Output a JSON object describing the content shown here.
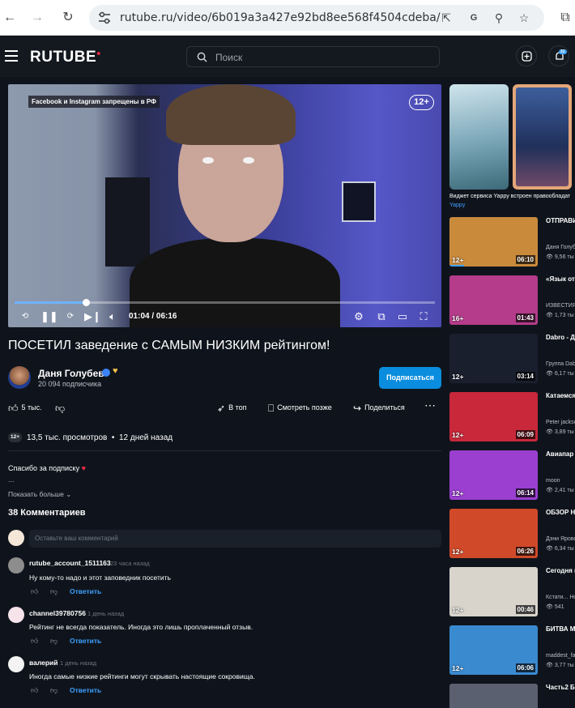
{
  "browser": {
    "url": "rutube.ru/video/6b019a3a427e92bd8ee568f4504cdeba/"
  },
  "header": {
    "logo": "RUTUBE",
    "search_placeholder": "Поиск",
    "notif_count": "31"
  },
  "player": {
    "overlay_tag": "Facebook и Instagram запрещены в РФ",
    "age_badge": "12+",
    "time": "01:04 / 06:16",
    "progress": 0.17
  },
  "video": {
    "title": "ПОСЕТИЛ заведение с САМЫМ НИЗКИМ рейтингом!",
    "channel": "Даня Голубев",
    "subscribers": "20 094 подписчика",
    "subscribe_label": "Подписаться",
    "likes": "5 тыс.",
    "actions": {
      "top": "В топ",
      "later": "Смотреть позже",
      "share": "Поделиться"
    },
    "age": "12+",
    "views": "13,5 тыс. просмотров",
    "date": "12 дней назад",
    "description": "Спасибо за подписку",
    "description_more": "...",
    "show_more": "Показать больше"
  },
  "comments": {
    "count_label": "38 Комментариев",
    "input_placeholder": "Оставьте ваш комментарий",
    "reply_label": "Ответить",
    "items": [
      {
        "user": "rutube_account_1511163",
        "time": "23 часа назад",
        "text": "Ну кому-то надо и этот заповедник посетить"
      },
      {
        "user": "channel39780756",
        "time": "1 день назад",
        "text": "Рейтинг не всегда показатель. Иногда это лишь проплаченный отзыв."
      },
      {
        "user": "валерий",
        "time": "1 день назад",
        "text": "Иногда самые низкие рейтинги могут скрывать настоящие сокровища."
      }
    ]
  },
  "sidebar": {
    "ad_text": "Виджет сервиса Yappy встроен правообладат",
    "ad_source": "Yappy",
    "cards": [
      {
        "title": "ОТПРАВИ лет НАЗА",
        "author": "Даня Голуб",
        "views": "9,56 ты",
        "age": "12+",
        "duration": "06:10",
        "bg": "#c98a3c"
      },
      {
        "title": "«Язык от домашни",
        "author": "ИЗВЕСТИЯ",
        "views": "1,73 ты",
        "age": "16+",
        "duration": "01:43",
        "bg": "#b43c8a"
      },
      {
        "title": "Dabro - Д навсегда",
        "author": "Группа Dabr",
        "views": "6,17 ты",
        "age": "12+",
        "duration": "03:14",
        "bg": "#1a1f2e"
      },
      {
        "title": "Катаемся Китайца",
        "author": "Peter jacksc",
        "views": "3,89 ты",
        "age": "12+",
        "duration": "06:09",
        "bg": "#c8283a"
      },
      {
        "title": "Авиапар Смешны",
        "author": "moon",
        "views": "2,41 ты",
        "age": "12+",
        "duration": "06:14",
        "bg": "#9a3fd0"
      },
      {
        "title": "ОБЗОР Н РЕАЛИТ",
        "author": "Дэни Яровс",
        "views": "6,34 ты",
        "age": "12+",
        "duration": "06:26",
        "bg": "#d04a2a"
      },
      {
        "title": "Сегодня программ",
        "author": "Кстати... Но",
        "views": "541",
        "age": "12+",
        "duration": "00:46",
        "bg": "#d8d4cc"
      },
      {
        "title": "БИТВА М Бешеная",
        "author": "maddest_fa",
        "views": "3,77 ты",
        "age": "12+",
        "duration": "06:06",
        "bg": "#3a8ad0"
      },
      {
        "title": "Часть2 Б массажн",
        "author": "",
        "views": "",
        "age": "",
        "duration": "",
        "bg": "#5a6070"
      }
    ]
  }
}
